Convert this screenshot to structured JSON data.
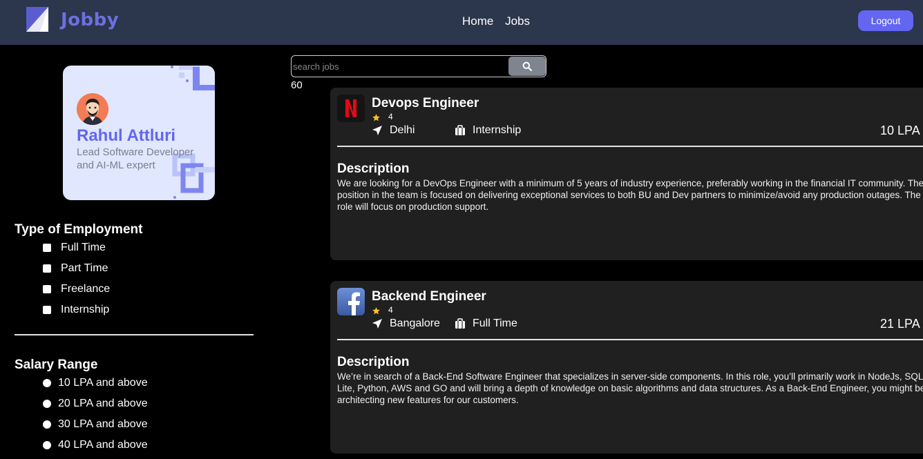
{
  "header": {
    "brand": "Jobby",
    "nav": [
      "Home",
      "Jobs"
    ],
    "logout_label": "Logout",
    "accent": "#6366f1",
    "bg": "#2c364c"
  },
  "profile": {
    "name": "Rahul Attluri",
    "bio": "Lead Software Developer and AI-ML expert"
  },
  "filters": {
    "employment_title": "Type of Employment",
    "employment_options": [
      "Full Time",
      "Part Time",
      "Freelance",
      "Internship"
    ],
    "salary_title": "Salary Range",
    "salary_options": [
      "10 LPA and above",
      "20 LPA and above",
      "30 LPA and above",
      "40 LPA and above"
    ]
  },
  "search": {
    "placeholder": "search jobs",
    "value": "",
    "icon": "search-icon"
  },
  "results_count": "60",
  "jobs": [
    {
      "title": "Devops Engineer",
      "company_icon": "netflix-logo",
      "rating": "4",
      "location": "Delhi",
      "employment_type": "Internship",
      "package": "10 LPA",
      "description_title": "Description",
      "description": "We are looking for a DevOps Engineer with a minimum of 5 years of industry experience, preferably working in the financial IT community. The position in the team is focused on delivering exceptional services to both BU and Dev partners to minimize/avoid any production outages. The role will focus on production support."
    },
    {
      "title": "Backend Engineer",
      "company_icon": "facebook-logo",
      "rating": "4",
      "location": "Bangalore",
      "employment_type": "Full Time",
      "package": "21 LPA",
      "description_title": "Description",
      "description": "We’re in search of a Back-End Software Engineer that specializes in server-side components. In this role, you’ll primarily work in NodeJs, SQL Lite, Python, AWS and GO and will bring a depth of knowledge on basic algorithms and data structures. As a Back-End Engineer, you might be architecting new features for our customers."
    }
  ]
}
